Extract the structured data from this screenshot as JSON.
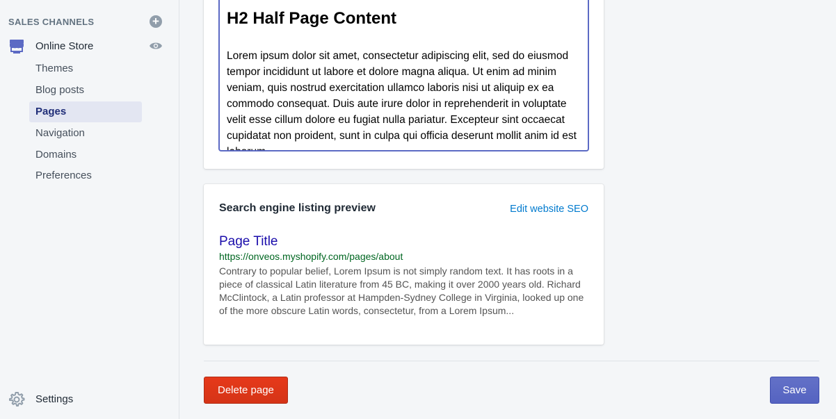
{
  "sidebar": {
    "section_title": "SALES CHANNELS",
    "add_icon": "plus-circle-icon",
    "channel": {
      "label": "Online Store",
      "icon": "store-icon",
      "view_icon": "eye-icon"
    },
    "items": [
      {
        "label": "Themes",
        "active": false
      },
      {
        "label": "Blog posts",
        "active": false
      },
      {
        "label": "Pages",
        "active": true
      },
      {
        "label": "Navigation",
        "active": false
      },
      {
        "label": "Domains",
        "active": false
      },
      {
        "label": "Preferences",
        "active": false
      }
    ],
    "settings": {
      "label": "Settings",
      "icon": "gear-icon"
    }
  },
  "editor": {
    "heading": "H2 Half Page Content",
    "body": "Lorem ipsum dolor sit amet, consectetur adipiscing elit, sed do eiusmod tempor incididunt ut labore et dolore magna aliqua. Ut enim ad minim veniam, quis nostrud exercitation ullamco laboris nisi ut aliquip ex ea commodo consequat. Duis aute irure dolor in reprehenderit in voluptate velit esse cillum dolore eu fugiat nulla pariatur. Excepteur sint occaecat cupidatat non proident, sunt in culpa qui officia deserunt mollit anim id est laborum."
  },
  "seo": {
    "title": "Search engine listing preview",
    "edit_link": "Edit website SEO",
    "page_title": "Page Title",
    "url": "https://onveos.myshopify.com/pages/about",
    "description": "Contrary to popular belief, Lorem Ipsum is not simply random text. It has roots in a piece of classical Latin literature from 45 BC, making it over 2000 years old. Richard McClintock, a Latin professor at Hampden-Sydney College in Virginia, looked up one of the more obscure Latin words, consectetur, from a Lorem Ipsum..."
  },
  "actions": {
    "delete_label": "Delete page",
    "save_label": "Save"
  },
  "colors": {
    "primary": "#5c6ac4",
    "danger": "#de3618",
    "link": "#007ace"
  }
}
